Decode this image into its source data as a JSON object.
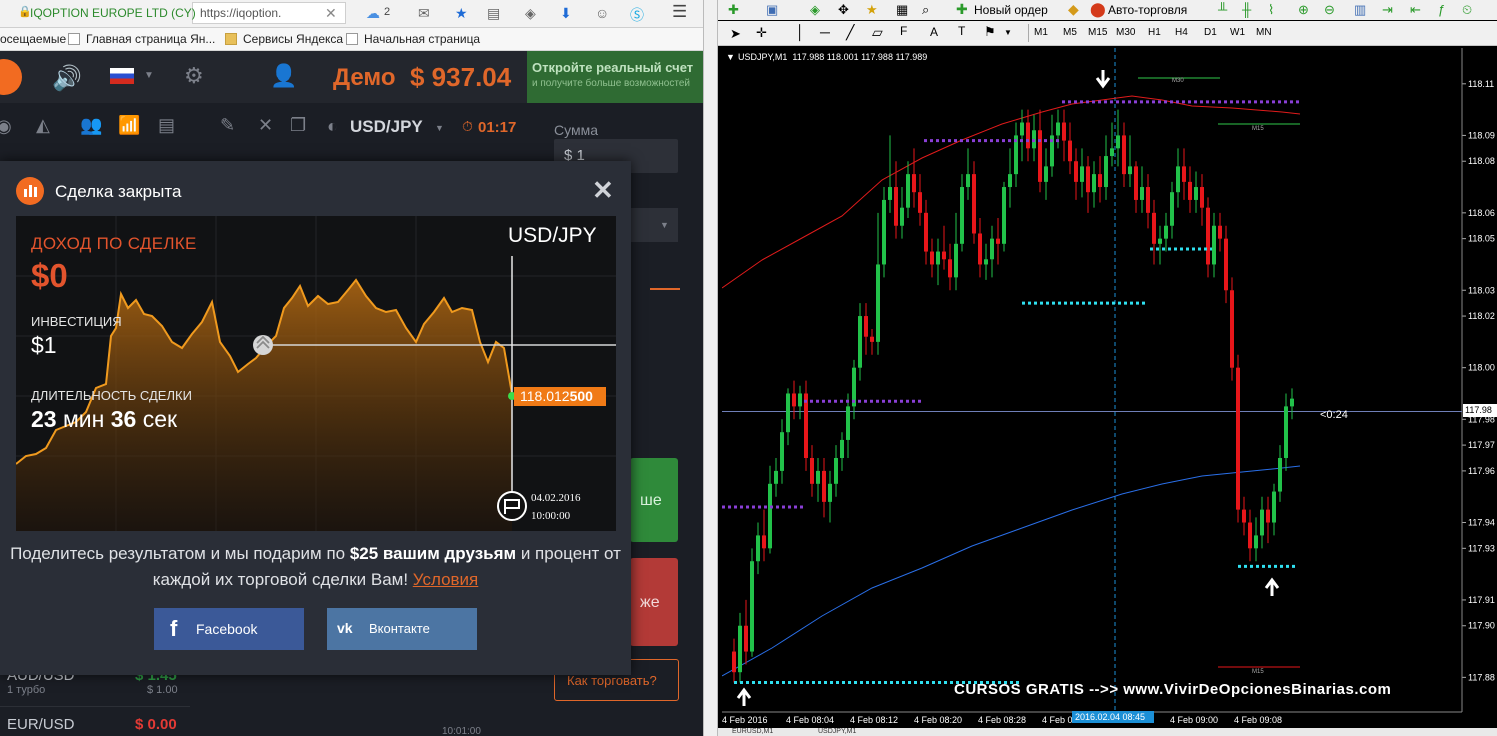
{
  "browser": {
    "site_identity": "IQOPTION EUROPE LTD (CY)",
    "url": "https://iqoption.",
    "badge_count": "2",
    "bookmarks": [
      "осещаемые",
      "Главная страница Ян...",
      "Сервисы Яндекса",
      "Начальная страница"
    ]
  },
  "iq": {
    "account_mode": "Демо",
    "balance": "$ 937.04",
    "real_account_title": "Откройте реальный счет",
    "real_account_sub": "и получите больше возможностей",
    "pair_selector": "USD/JPY",
    "timer": "01:17",
    "sum_label": "Сумма",
    "sum_value": "$ 1",
    "higher_fragment": "ше",
    "lower_fragment": "же",
    "how_to_trade": "Как торговать?",
    "assets": [
      {
        "name": "AUD/USD",
        "sub": "1 турбо",
        "value": "$ 1.45",
        "value_sub": "$ 1.00"
      },
      {
        "name": "EUR/USD",
        "sub": "",
        "value": "$ 0.00",
        "value_sub": ""
      }
    ],
    "clock_label": "10:01:00"
  },
  "modal": {
    "title": "Сделка закрыта",
    "profit_label": "ДОХОД ПО СДЕЛКЕ",
    "profit_value": "$0",
    "invest_label": "ИНВЕСТИЦИЯ",
    "invest_value": "$1",
    "duration_label": "ДЛИТЕЛЬНОСТЬ СДЕЛКИ",
    "duration_value": "23 мин 36 сек",
    "chart_pair": "USD/JPY",
    "price_tag_main": "118.012",
    "price_tag_bold": "500",
    "expiry_date": "04.02.2016",
    "expiry_time": "10:00:00",
    "share_part1": "Поделитесь результатом и мы подарим по ",
    "share_bold": "$25 вашим друзьям",
    "share_part2": " и процент от каждой их торговой сделки Вам! ",
    "terms_link": "Условия",
    "facebook_button": "Facebook",
    "vk_button": "Вконтакте"
  },
  "mt4": {
    "new_order": "Новый ордер",
    "auto_trading": "Авто-торговля",
    "timeframes": [
      "M1",
      "M5",
      "M15",
      "M30",
      "H1",
      "H4",
      "D1",
      "W1",
      "MN"
    ],
    "symbol_info": "USDJPY,M1  117.988 118.001 117.988 117.989",
    "countdown": "<0:24",
    "current_price": "117.98",
    "watermark": "CURSOS GRATIS -->> www.VivirDeOpcionesBinarias.com",
    "label_m30": "M30",
    "label_m15": "M15",
    "price_axis": [
      "118.11",
      "118.09",
      "118.08",
      "118.06",
      "118.05",
      "118.03",
      "118.02",
      "118.00",
      "117.98",
      "117.97",
      "117.96",
      "117.94",
      "117.93",
      "117.91",
      "117.90",
      "117.88"
    ],
    "time_axis": [
      "4 Feb 2016",
      "4 Feb 08:04",
      "4 Feb 08:12",
      "4 Feb 08:20",
      "4 Feb 08:28",
      "4 Feb 0",
      "4 Feb 08:52",
      "4 Feb 09:00",
      "4 Feb 09:08"
    ],
    "crosshair_time": "2016.02.04 08:45",
    "tabs": [
      "EURUSD,M1",
      "USDJPY,M1"
    ]
  },
  "colors": {
    "accent": "#e0672a",
    "bull": "#22c24a",
    "bear": "#e8161a",
    "purple_level": "#8a3fd6",
    "cyan_level": "#2fe0f0",
    "ma_red": "#e01b1b",
    "ma_blue": "#2a6fe8"
  }
}
